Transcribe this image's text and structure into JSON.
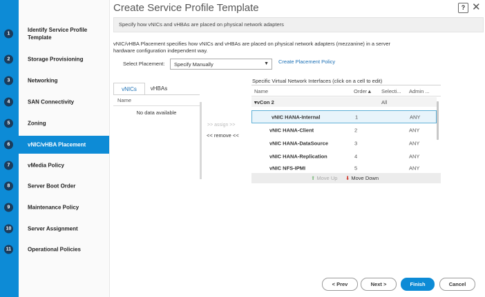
{
  "window": {
    "title": "Create Service Profile Template",
    "help": "?",
    "close": "✕",
    "subtitle": "Specify how vNICs and vHBAs are placed on physical network adapters"
  },
  "steps": [
    {
      "num": "1",
      "label": "Identify Service Profile Template"
    },
    {
      "num": "2",
      "label": "Storage Provisioning"
    },
    {
      "num": "3",
      "label": "Networking"
    },
    {
      "num": "4",
      "label": "SAN Connectivity"
    },
    {
      "num": "5",
      "label": "Zoning"
    },
    {
      "num": "6",
      "label": "vNIC/vHBA Placement",
      "active": true
    },
    {
      "num": "7",
      "label": "vMedia Policy"
    },
    {
      "num": "8",
      "label": "Server Boot Order"
    },
    {
      "num": "9",
      "label": "Maintenance Policy"
    },
    {
      "num": "10",
      "label": "Server Assignment"
    },
    {
      "num": "11",
      "label": "Operational Policies"
    }
  ],
  "main": {
    "description": "vNIC/vHBA Placement specifies how vNICs and vHBAs are placed on physical network adapters (mezzanine) in a server hardware configuration independent way.",
    "placement_label": "Select Placement:",
    "placement_value": "Specify Manually",
    "placement_caret": "▼",
    "create_policy_link": "Create Placement Policy",
    "tabs": [
      {
        "label": "vNICs"
      },
      {
        "label": "vHBAs"
      }
    ],
    "left_header": "Name",
    "empty_text": "No data available",
    "assign_label": ">> assign >>",
    "remove_label": "<< remove <<",
    "right_title": "Specific Virtual Network Interfaces (click on a cell to edit)",
    "columns": {
      "name": "Name",
      "order": "Order▲",
      "selection": "Selecti...",
      "admin": "Admin ..."
    },
    "group": {
      "name": "▾vCon 2",
      "selection": "All"
    },
    "rows": [
      {
        "name": "vNIC HANA-Internal",
        "order": "1",
        "admin": "ANY"
      },
      {
        "name": "vNIC HANA-Client",
        "order": "2",
        "admin": "ANY"
      },
      {
        "name": "vNIC HANA-DataSource",
        "order": "3",
        "admin": "ANY"
      },
      {
        "name": "vNIC HANA-Replication",
        "order": "4",
        "admin": "ANY"
      },
      {
        "name": "vNIC NFS-IPMI",
        "order": "5",
        "admin": "ANY"
      }
    ],
    "move_up": "Move Up",
    "move_down": "Move Down",
    "arrow_up": "⬆",
    "arrow_down": "⬇"
  },
  "footer": {
    "prev": "< Prev",
    "next": "Next >",
    "finish": "Finish",
    "cancel": "Cancel"
  },
  "colors": {
    "accent": "#0d8bd6",
    "step_badge": "#1b3c5c",
    "selected_row": "#e8f4fb"
  }
}
